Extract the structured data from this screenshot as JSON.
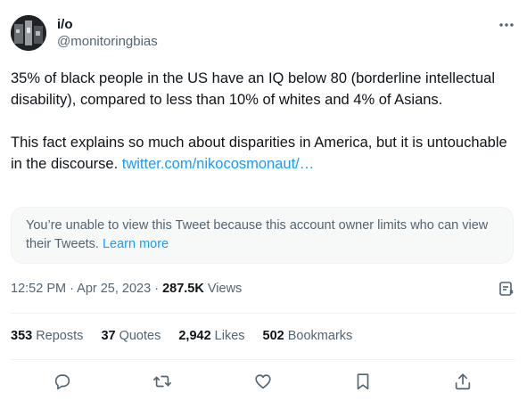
{
  "author": {
    "display_name": "i/o",
    "handle": "@monitoringbias"
  },
  "tweet": {
    "text": "35% of black people in the US have an IQ below 80 (borderline intellectual disability), compared to less than 10% of whites and 4% of Asians.\n\nThis fact explains so much about disparities in America, but it is untouchable in the discourse. ",
    "link": "twitter.com/nikocosmonaut/…"
  },
  "quoted_notice": {
    "text": "You’re unable to view this Tweet because this account owner limits who can view their Tweets. ",
    "learn_more": "Learn more"
  },
  "meta": {
    "timestamp": "12:52 PM · Apr 25, 2023 · ",
    "views_count": "287.5K",
    "views_label": " Views"
  },
  "stats": {
    "reposts_count": "353",
    "reposts_label": "Reposts",
    "quotes_count": "37",
    "quotes_label": "Quotes",
    "likes_count": "2,942",
    "likes_label": "Likes",
    "bookmarks_count": "502",
    "bookmarks_label": "Bookmarks"
  },
  "icons": [
    "more-icon",
    "grok-icon",
    "reply-icon",
    "repost-icon",
    "like-icon",
    "bookmark-icon",
    "share-icon"
  ],
  "colors": {
    "link": "#1d9bf0",
    "secondary_text": "#536471",
    "primary_text": "#0f1419"
  }
}
